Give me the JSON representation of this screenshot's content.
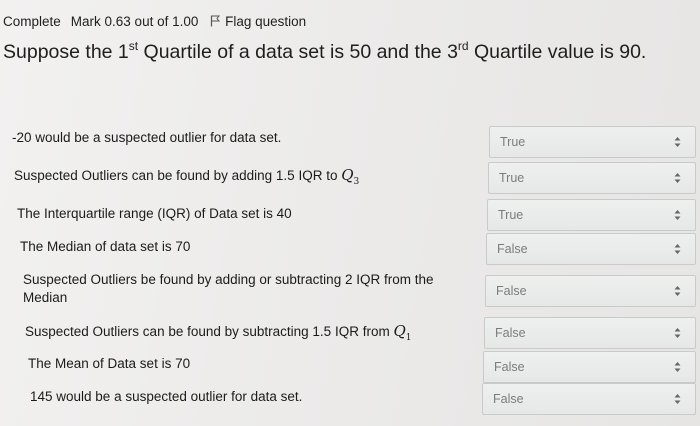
{
  "status": {
    "state": "Complete",
    "mark": "Mark 0.63 out of 1.00",
    "flag_label": "Flag question"
  },
  "question": {
    "part1": "Suppose the 1",
    "sup1": "st",
    "part2": " Quartile of a data set is 50 and the 3",
    "sup2": "rd",
    "part3": " Quartile value is 90."
  },
  "rows": [
    {
      "text": "-20 would be a suspected outlier for data set.",
      "answer": "True"
    },
    {
      "text": "Suspected Outliers can be found by adding 1.5 IQR to",
      "math": "Q",
      "sub": "3",
      "answer": "True"
    },
    {
      "text": "The Interquartile range (IQR) of Data set is 40",
      "answer": "True"
    },
    {
      "text": "The Median of data set is 70",
      "answer": "False"
    },
    {
      "text": "Suspected Outliers be found by adding or subtracting 2 IQR from the Median",
      "answer": "False"
    },
    {
      "text": "Suspected Outliers can be found by subtracting 1.5 IQR from",
      "math": "Q",
      "sub": "1",
      "answer": "False"
    },
    {
      "text": "The Mean of Data set is 70",
      "answer": "False"
    },
    {
      "text": "145 would be a suspected outlier for data set.",
      "answer": "False"
    }
  ],
  "icons": {
    "flag": "flag-icon",
    "select_arrows": "select-arrows-icon"
  }
}
